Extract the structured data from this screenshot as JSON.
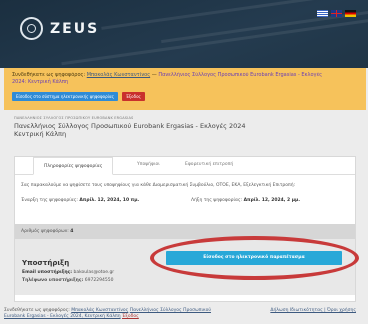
{
  "header": {
    "brand": "ZEUS",
    "languages": [
      "el",
      "en",
      "de"
    ]
  },
  "notice": {
    "prefix": "Συνδεθήκατε ως ψηφοφόρος:",
    "voter_link": "Μπακολάς Κωνσταντίνος",
    "separator": " — ",
    "election_link": "Πανελλήνιος Σύλλογος Προσωπικού Eurobank Ergasias - Εκλογές",
    "election_cont": "2024: Κεντρική Κάλπη",
    "primary_button": "Είσοδος στο σύστημα ηλεκτρονικής ψηφοφορίας",
    "logout_button": "Έξοδος"
  },
  "title_area": {
    "caption": "ΠΑΝΕΛΛΗΝΙΟΣ ΣΥΛΛΟΓΟΣ ΠΡΟΣΩΠΙΚΟΥ EUROBANK ERGASIAS",
    "title_line1": "Πανελλήνιος Σύλλογος Προσωπικού Eurobank Ergasias - Εκλογές 2024",
    "title_line2": "Κεντρική Κάλπη"
  },
  "tabs": [
    "Πληροφορίες ψηφοφορίας",
    "Υποψήφιοι",
    "Εφορευτική επιτροπή"
  ],
  "card": {
    "intro": "Σας παρακαλούμε να ψηφίσετε τους υποψηφίους για κάθε Διαμερισματική Συμβούλιο, ΟΤΟΕ, ΕΚΑ, Εξελεγκτική Επιτροπή:",
    "start_label": "Έναρξη της ψηφοφορίας:",
    "start_value": "Απρίλ. 12, 2024, 10 πμ.",
    "end_label": "Λήξη της ψηφοφορίας:",
    "end_value": "Απρίλ. 12, 2024, 2 μμ.",
    "ballots_label": "Αριθμός ψηφοφόρων:",
    "ballots_value": "4",
    "support_title": "Υποστήριξη",
    "support_email_label": "Email υποστήριξης:",
    "support_email": "bakoulas@otoe.gr",
    "support_phone_label": "Τηλέφωνο υποστήριξης:",
    "support_phone": "6972294550",
    "enter_button": "Είσοδος στο ηλεκτρονικό παραπέτασμα"
  },
  "footer": {
    "prefix": "Συνδεθήκατε ως ψηφοφόρος:",
    "voter_link": "Μπακολάς Κωνσταντίνος",
    "election_link": "Πανελλήνιος Σύλλογος Προσωπικού",
    "election_cont": "Eurobank Ergasias - Εκλογές 2024, Κεντρική Κάλπη",
    "logout": "Έξοδος",
    "right_link": "Δήλωση Ιδιωτικότητας | Όροι χρήσης"
  }
}
